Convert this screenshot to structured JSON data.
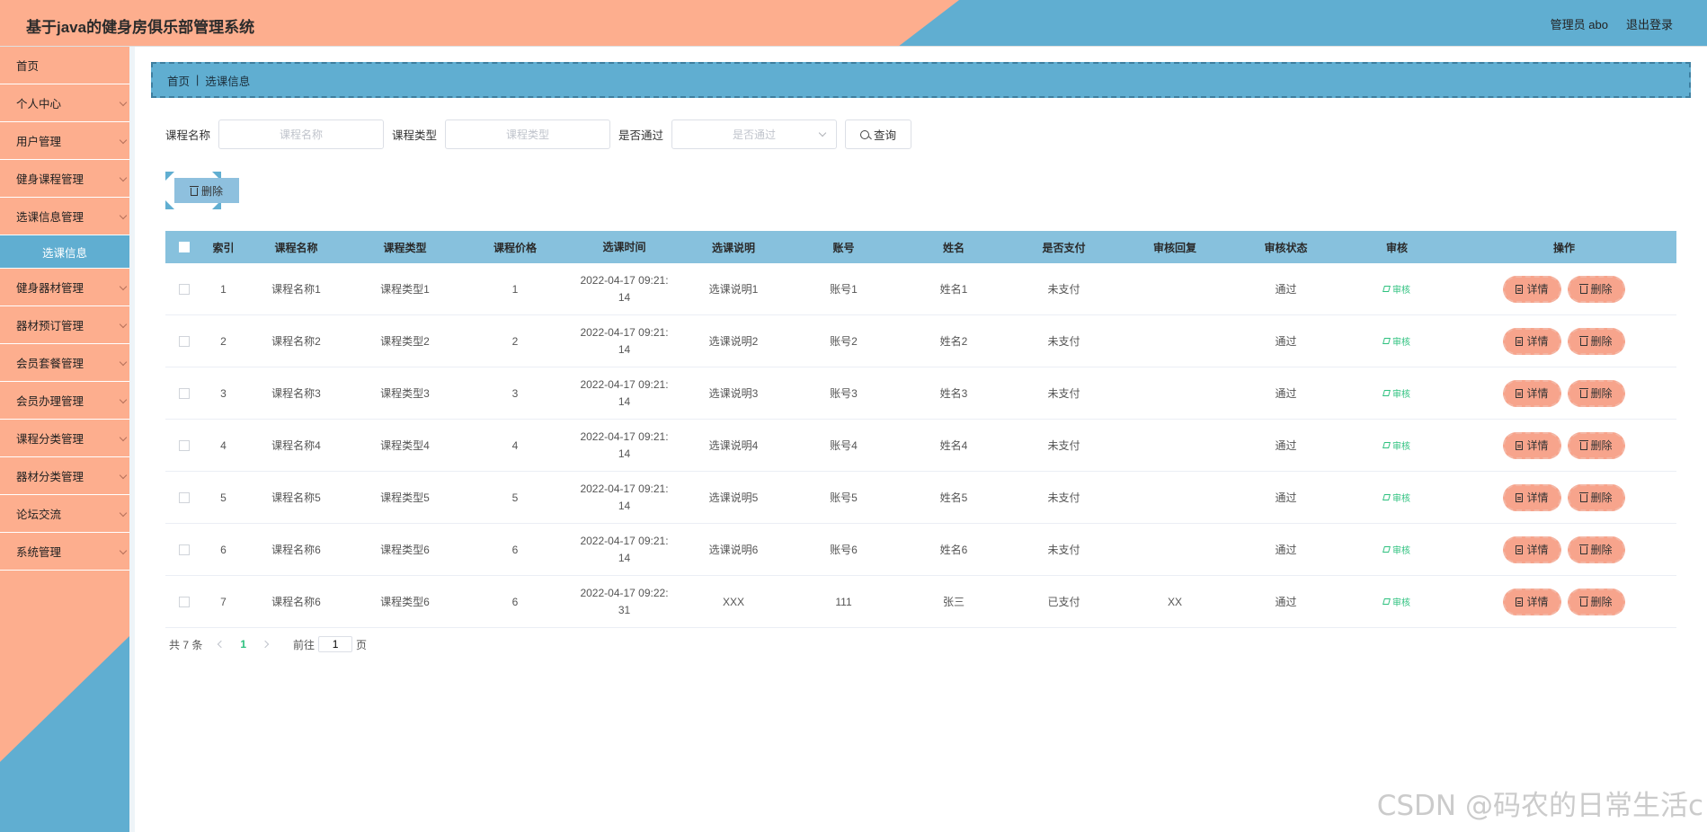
{
  "header": {
    "title": "基于java的健身房俱乐部管理系统",
    "user_label": "管理员 abo",
    "logout_label": "退出登录"
  },
  "sidebar": {
    "items": [
      {
        "label": "首页"
      },
      {
        "label": "个人中心"
      },
      {
        "label": "用户管理"
      },
      {
        "label": "健身课程管理"
      },
      {
        "label": "选课信息管理"
      },
      {
        "label": "选课信息"
      },
      {
        "label": "健身器材管理"
      },
      {
        "label": "器材预订管理"
      },
      {
        "label": "会员套餐管理"
      },
      {
        "label": "会员办理管理"
      },
      {
        "label": "课程分类管理"
      },
      {
        "label": "器材分类管理"
      },
      {
        "label": "论坛交流"
      },
      {
        "label": "系统管理"
      }
    ]
  },
  "breadcrumb": {
    "home": "首页",
    "current": "选课信息"
  },
  "search": {
    "course_name_label": "课程名称",
    "course_name_placeholder": "课程名称",
    "course_type_label": "课程类型",
    "course_type_placeholder": "课程类型",
    "pass_label": "是否通过",
    "pass_placeholder": "是否通过",
    "query_label": "查询"
  },
  "actions": {
    "delete_label": "删除"
  },
  "table": {
    "headers": [
      "索引",
      "课程名称",
      "课程类型",
      "课程价格",
      "选课时间",
      "选课说明",
      "账号",
      "姓名",
      "是否支付",
      "审核回复",
      "审核状态",
      "审核",
      "操作"
    ],
    "audit_label": "审核",
    "detail_label": "详情",
    "delete_label": "删除",
    "rows": [
      {
        "idx": "1",
        "name": "课程名称1",
        "type": "课程类型1",
        "price": "1",
        "time1": "2022-04-17 09:21:",
        "time2": "14",
        "desc": "选课说明1",
        "account": "账号1",
        "realname": "姓名1",
        "paid": "未支付",
        "reply": "",
        "status": "通过"
      },
      {
        "idx": "2",
        "name": "课程名称2",
        "type": "课程类型2",
        "price": "2",
        "time1": "2022-04-17 09:21:",
        "time2": "14",
        "desc": "选课说明2",
        "account": "账号2",
        "realname": "姓名2",
        "paid": "未支付",
        "reply": "",
        "status": "通过"
      },
      {
        "idx": "3",
        "name": "课程名称3",
        "type": "课程类型3",
        "price": "3",
        "time1": "2022-04-17 09:21:",
        "time2": "14",
        "desc": "选课说明3",
        "account": "账号3",
        "realname": "姓名3",
        "paid": "未支付",
        "reply": "",
        "status": "通过"
      },
      {
        "idx": "4",
        "name": "课程名称4",
        "type": "课程类型4",
        "price": "4",
        "time1": "2022-04-17 09:21:",
        "time2": "14",
        "desc": "选课说明4",
        "account": "账号4",
        "realname": "姓名4",
        "paid": "未支付",
        "reply": "",
        "status": "通过"
      },
      {
        "idx": "5",
        "name": "课程名称5",
        "type": "课程类型5",
        "price": "5",
        "time1": "2022-04-17 09:21:",
        "time2": "14",
        "desc": "选课说明5",
        "account": "账号5",
        "realname": "姓名5",
        "paid": "未支付",
        "reply": "",
        "status": "通过"
      },
      {
        "idx": "6",
        "name": "课程名称6",
        "type": "课程类型6",
        "price": "6",
        "time1": "2022-04-17 09:21:",
        "time2": "14",
        "desc": "选课说明6",
        "account": "账号6",
        "realname": "姓名6",
        "paid": "未支付",
        "reply": "",
        "status": "通过"
      },
      {
        "idx": "7",
        "name": "课程名称6",
        "type": "课程类型6",
        "price": "6",
        "time1": "2022-04-17 09:22:",
        "time2": "31",
        "desc": "XXX",
        "account": "111",
        "realname": "张三",
        "paid": "已支付",
        "reply": "XX",
        "status": "通过"
      }
    ]
  },
  "pagination": {
    "total_label": "共 7 条",
    "current_page": "1",
    "goto_label": "前往",
    "goto_value": "1",
    "page_suffix": "页"
  },
  "watermark": "CSDN @码农的日常生活c",
  "colors": {
    "accent_orange": "#fdae8e",
    "accent_blue": "#60aed1",
    "table_header": "#87c1dd",
    "link_green": "#2ec17f"
  }
}
